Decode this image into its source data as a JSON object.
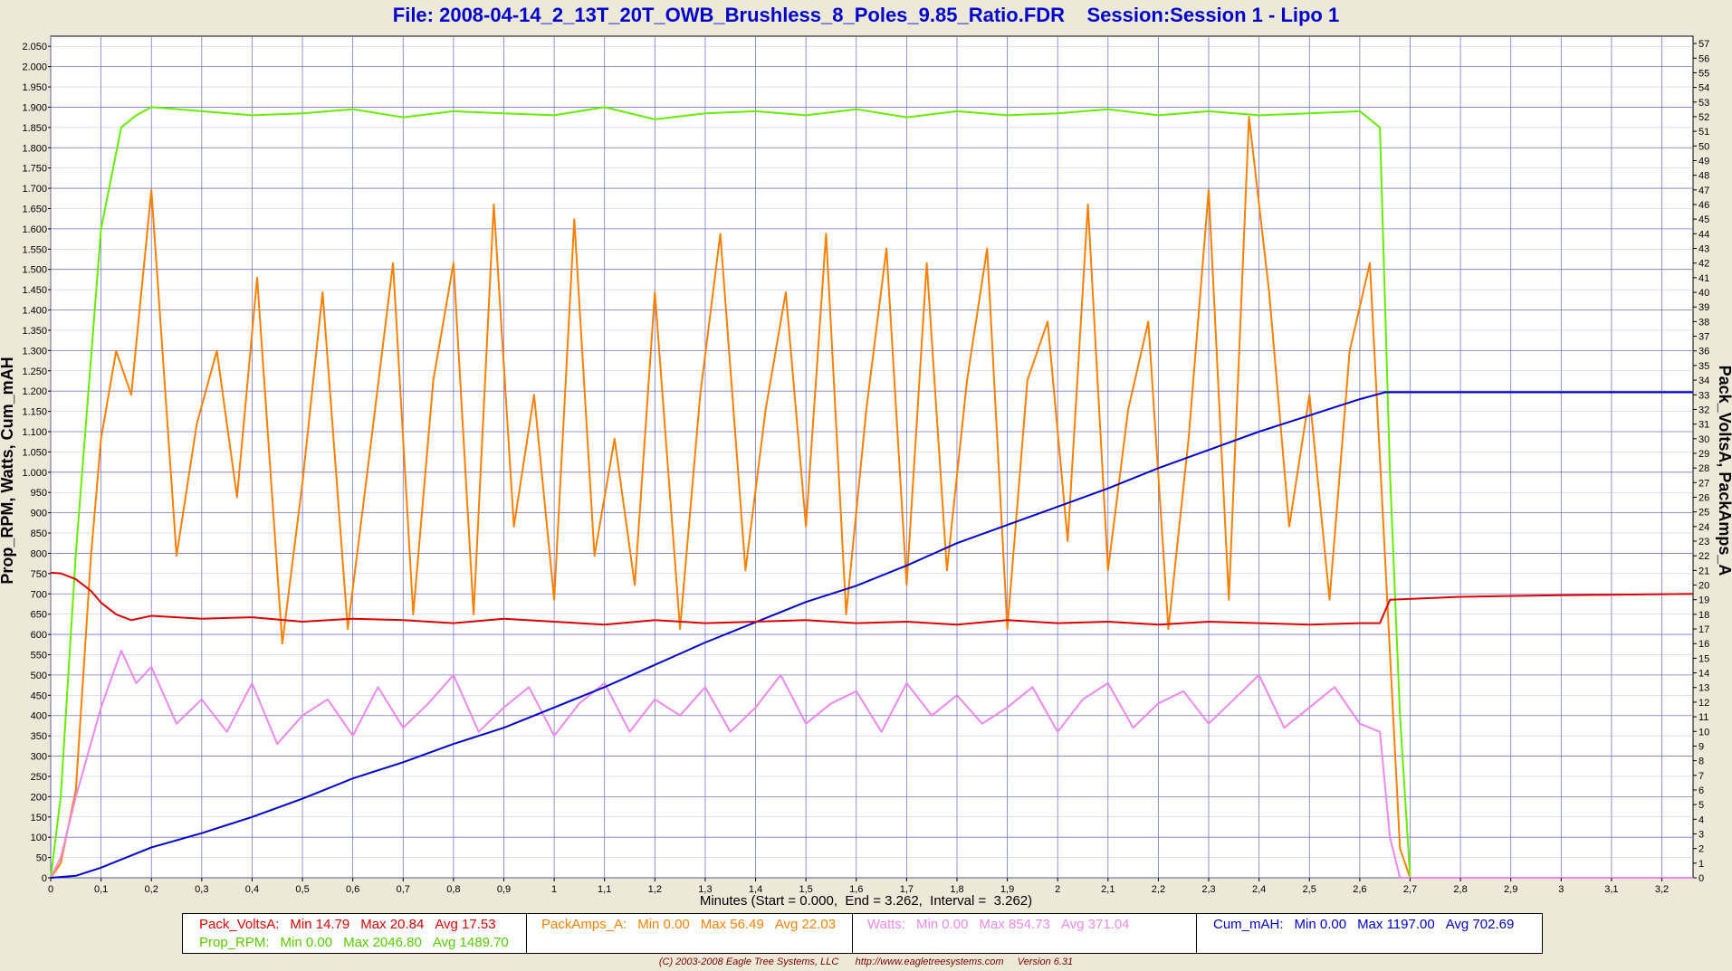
{
  "title": "File: 2008-04-14_2_13T_20T_OWB_Brushless_8_Poles_9.85_Ratio.FDR    Session:Session 1 - Lipo 1",
  "chart_data": {
    "type": "line",
    "title": "File: 2008-04-14_2_13T_20T_OWB_Brushless_8_Poles_9.85_Ratio.FDR    Session:Session 1 - Lipo 1",
    "xlabel": "Minutes (Start = 0.000,  End = 3.262,  Interval =  3.262)",
    "ylabel_left": "Prop_RPM, Watts, Cum_mAH",
    "ylabel_right": "Pack_VoltsA, PackAmps_A",
    "xlim": [
      0,
      3.262
    ],
    "ylim_left": [
      0,
      2075
    ],
    "ylim_right": [
      0,
      57.5
    ],
    "x_ticks": [
      0,
      0.1,
      0.2,
      0.3,
      0.4,
      0.5,
      0.6,
      0.7,
      0.8,
      0.9,
      1,
      1.1,
      1.2,
      1.3,
      1.4,
      1.5,
      1.6,
      1.7,
      1.8,
      1.9,
      2,
      2.1,
      2.2,
      2.3,
      2.4,
      2.5,
      2.6,
      2.7,
      2.8,
      2.9,
      3,
      3.1,
      3.2
    ],
    "x_tick_labels": [
      "0",
      "0,1",
      "0,2",
      "0,3",
      "0,4",
      "0,5",
      "0,6",
      "0,7",
      "0,8",
      "0,9",
      "1",
      "1,1",
      "1,2",
      "1,3",
      "1,4",
      "1,5",
      "1,6",
      "1,7",
      "1,8",
      "1,9",
      "2",
      "2,1",
      "2,2",
      "2,3",
      "2,4",
      "2,5",
      "2,6",
      "2,7",
      "2,8",
      "2,9",
      "3",
      "3,1",
      "3,2"
    ],
    "grid": true,
    "series": [
      {
        "name": "PackAmps_A",
        "axis": "right",
        "color": "#ff8000",
        "x": [
          0,
          0.02,
          0.05,
          0.08,
          0.1,
          0.13,
          0.16,
          0.2,
          0.25,
          0.29,
          0.33,
          0.37,
          0.41,
          0.46,
          0.5,
          0.54,
          0.59,
          0.63,
          0.68,
          0.72,
          0.76,
          0.8,
          0.84,
          0.88,
          0.92,
          0.96,
          1.0,
          1.04,
          1.08,
          1.12,
          1.16,
          1.2,
          1.25,
          1.29,
          1.33,
          1.38,
          1.42,
          1.46,
          1.5,
          1.54,
          1.58,
          1.62,
          1.66,
          1.7,
          1.74,
          1.78,
          1.82,
          1.86,
          1.9,
          1.94,
          1.98,
          2.02,
          2.06,
          2.1,
          2.14,
          2.18,
          2.22,
          2.26,
          2.3,
          2.34,
          2.38,
          2.42,
          2.46,
          2.5,
          2.54,
          2.58,
          2.62,
          2.65,
          2.68,
          2.7,
          3.262
        ],
        "values": [
          0,
          1,
          6,
          22,
          30,
          36,
          33,
          47,
          22,
          31,
          36,
          26,
          41,
          16,
          27,
          40,
          17,
          28,
          42,
          18,
          34,
          42,
          18,
          46,
          24,
          33,
          19,
          45,
          22,
          30,
          20,
          40,
          17,
          33,
          44,
          21,
          32,
          40,
          24,
          44,
          18,
          32,
          43,
          20,
          42,
          21,
          34,
          43,
          17,
          34,
          38,
          23,
          46,
          21,
          32,
          38,
          17,
          30,
          47,
          19,
          52,
          40,
          24,
          33,
          19,
          36,
          42,
          22,
          2,
          0,
          0
        ]
      },
      {
        "name": "Prop_RPM",
        "axis": "left",
        "color": "#66ee00",
        "x": [
          0,
          0.02,
          0.05,
          0.1,
          0.14,
          0.17,
          0.2,
          0.3,
          0.4,
          0.5,
          0.6,
          0.7,
          0.8,
          0.9,
          1.0,
          1.1,
          1.2,
          1.3,
          1.4,
          1.5,
          1.6,
          1.7,
          1.8,
          1.9,
          2.0,
          2.1,
          2.2,
          2.3,
          2.4,
          2.5,
          2.6,
          2.64,
          2.66,
          2.68,
          2.7,
          3.262
        ],
        "values": [
          0,
          200,
          800,
          1600,
          1850,
          1880,
          1900,
          1890,
          1880,
          1885,
          1895,
          1875,
          1890,
          1885,
          1880,
          1900,
          1870,
          1885,
          1890,
          1880,
          1895,
          1875,
          1890,
          1880,
          1885,
          1895,
          1880,
          1890,
          1880,
          1885,
          1890,
          1850,
          1000,
          400,
          0,
          0
        ]
      },
      {
        "name": "Watts",
        "axis": "left",
        "color": "#ee88ee",
        "x": [
          0,
          0.02,
          0.05,
          0.1,
          0.14,
          0.17,
          0.2,
          0.25,
          0.3,
          0.35,
          0.4,
          0.45,
          0.5,
          0.55,
          0.6,
          0.65,
          0.7,
          0.75,
          0.8,
          0.85,
          0.9,
          0.95,
          1.0,
          1.05,
          1.1,
          1.15,
          1.2,
          1.25,
          1.3,
          1.35,
          1.4,
          1.45,
          1.5,
          1.55,
          1.6,
          1.65,
          1.7,
          1.75,
          1.8,
          1.85,
          1.9,
          1.95,
          2.0,
          2.05,
          2.1,
          2.15,
          2.2,
          2.25,
          2.3,
          2.35,
          2.4,
          2.45,
          2.5,
          2.55,
          2.6,
          2.64,
          2.66,
          2.68,
          3.262
        ],
        "values": [
          0,
          50,
          200,
          420,
          560,
          480,
          520,
          380,
          440,
          360,
          480,
          330,
          400,
          440,
          350,
          470,
          370,
          430,
          500,
          360,
          420,
          470,
          350,
          430,
          480,
          360,
          440,
          400,
          470,
          360,
          420,
          500,
          380,
          430,
          460,
          360,
          480,
          400,
          450,
          380,
          420,
          470,
          360,
          440,
          480,
          370,
          430,
          460,
          380,
          440,
          500,
          370,
          420,
          470,
          380,
          360,
          100,
          0,
          0
        ]
      },
      {
        "name": "Cum_mAH",
        "axis": "left",
        "color": "#0000cc",
        "x": [
          0,
          0.05,
          0.1,
          0.2,
          0.3,
          0.4,
          0.5,
          0.6,
          0.7,
          0.8,
          0.9,
          1.0,
          1.1,
          1.2,
          1.3,
          1.4,
          1.5,
          1.6,
          1.7,
          1.8,
          1.9,
          2.0,
          2.1,
          2.2,
          2.3,
          2.4,
          2.5,
          2.6,
          2.65,
          3.262
        ],
        "values": [
          0,
          5,
          25,
          75,
          110,
          150,
          195,
          245,
          285,
          330,
          370,
          420,
          470,
          525,
          580,
          630,
          680,
          720,
          770,
          825,
          870,
          915,
          960,
          1010,
          1055,
          1100,
          1140,
          1180,
          1197,
          1197
        ]
      },
      {
        "name": "Pack_VoltsA",
        "axis": "right",
        "color": "#dd0000",
        "x": [
          0,
          0.02,
          0.05,
          0.08,
          0.1,
          0.13,
          0.16,
          0.2,
          0.3,
          0.4,
          0.5,
          0.6,
          0.7,
          0.8,
          0.9,
          1.0,
          1.1,
          1.2,
          1.3,
          1.4,
          1.5,
          1.6,
          1.7,
          1.8,
          1.9,
          2.0,
          2.1,
          2.2,
          2.3,
          2.4,
          2.5,
          2.6,
          2.64,
          2.66,
          2.8,
          3.0,
          3.262
        ],
        "values": [
          20.84,
          20.8,
          20.4,
          19.6,
          18.8,
          18.0,
          17.6,
          17.9,
          17.7,
          17.8,
          17.5,
          17.7,
          17.6,
          17.4,
          17.7,
          17.5,
          17.3,
          17.6,
          17.4,
          17.5,
          17.6,
          17.4,
          17.5,
          17.3,
          17.6,
          17.4,
          17.5,
          17.3,
          17.5,
          17.4,
          17.3,
          17.4,
          17.4,
          19.0,
          19.2,
          19.3,
          19.4
        ]
      }
    ]
  },
  "left_ticks": [
    "0",
    "50",
    "100",
    "150",
    "200",
    "250",
    "300",
    "350",
    "400",
    "450",
    "500",
    "550",
    "600",
    "650",
    "700",
    "750",
    "800",
    "850",
    "900",
    "950",
    "1.000",
    "1.050",
    "1.100",
    "1.150",
    "1.200",
    "1.250",
    "1.300",
    "1.350",
    "1.400",
    "1.450",
    "1.500",
    "1.550",
    "1.600",
    "1.650",
    "1.700",
    "1.750",
    "1.800",
    "1.850",
    "1.900",
    "1.950",
    "2.000",
    "2.050"
  ],
  "right_ticks": [
    "0",
    "1",
    "2",
    "3",
    "4",
    "5",
    "6",
    "7",
    "8",
    "9",
    "10",
    "11",
    "12",
    "13",
    "14",
    "15",
    "16",
    "17",
    "18",
    "19",
    "20",
    "21",
    "22",
    "23",
    "24",
    "25",
    "26",
    "27",
    "28",
    "29",
    "30",
    "31",
    "32",
    "33",
    "34",
    "35",
    "36",
    "37",
    "38",
    "39",
    "40",
    "41",
    "42",
    "43",
    "44",
    "45",
    "46",
    "47",
    "48",
    "49",
    "50",
    "51",
    "52",
    "53",
    "54",
    "55",
    "56",
    "57"
  ],
  "legend": {
    "volts_label": "Pack_VoltsA:",
    "volts_min": "Min 14.79",
    "volts_max": "Max 20.84",
    "volts_avg": "Avg 17.53",
    "rpm_label": "Prop_RPM:",
    "rpm_min": "Min 0.00",
    "rpm_max": "Max 2046.80",
    "rpm_avg": "Avg 1489.70",
    "amps_label": "PackAmps_A:",
    "amps_min": "Min 0.00",
    "amps_max": "Max 56.49",
    "amps_avg": "Avg 22.03",
    "watts_label": "Watts:",
    "watts_min": "Min 0.00",
    "watts_max": "Max 854.73",
    "watts_avg": "Avg 371.04",
    "mah_label": "Cum_mAH:",
    "mah_min": "Min 0.00",
    "mah_max": "Max 1197.00",
    "mah_avg": "Avg 702.69"
  },
  "footer": "(C) 2003-2008 Eagle Tree Systems, LLC      http://www.eagletreesystems.com     Version 6.31"
}
